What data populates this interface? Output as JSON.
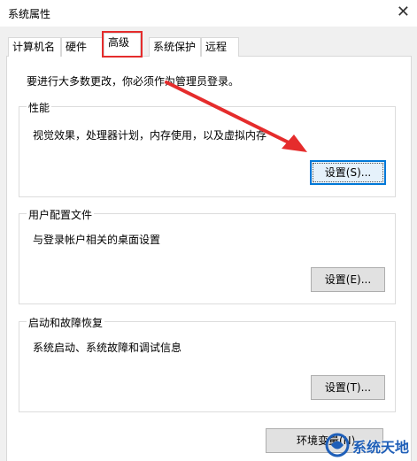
{
  "window": {
    "title": "系统属性",
    "close_glyph": "✕"
  },
  "tabs": [
    {
      "label": "计算机名"
    },
    {
      "label": "硬件"
    },
    {
      "label": "高级",
      "active": true
    },
    {
      "label": "系统保护"
    },
    {
      "label": "远程"
    }
  ],
  "notice": "要进行大多数更改，你必须作为管理员登录。",
  "performance": {
    "title": "性能",
    "description": "视觉效果，处理器计划，内存使用，以及虚拟内存",
    "button": "设置(S)..."
  },
  "user_profiles": {
    "title": "用户配置文件",
    "description": "与登录帐户相关的桌面设置",
    "button": "设置(E)..."
  },
  "startup_recovery": {
    "title": "启动和故障恢复",
    "description": "系统启动、系统故障和调试信息",
    "button": "设置(T)..."
  },
  "env_button": "环境变量(N)...",
  "watermark": {
    "text": "系统天地"
  },
  "colors": {
    "highlight_red": "#e52c2c",
    "focus_blue": "#0078d7",
    "watermark_blue": "#1f5fb8"
  }
}
